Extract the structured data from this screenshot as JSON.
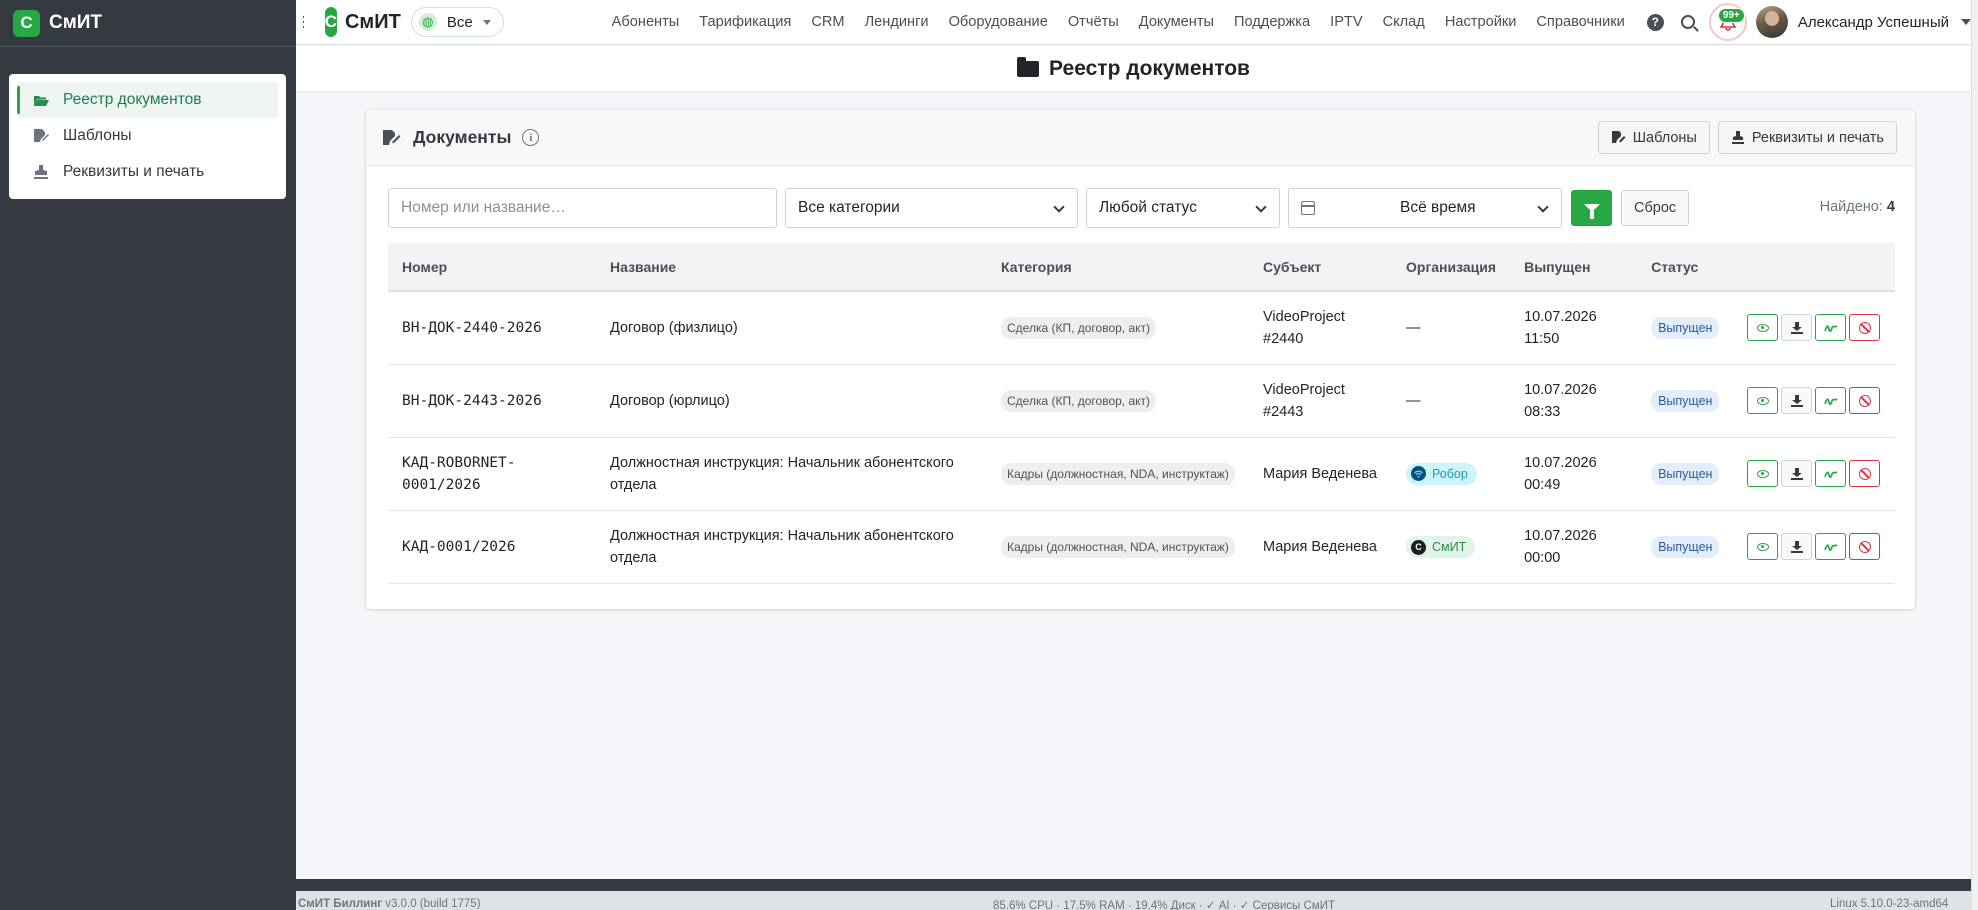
{
  "sidebar": {
    "brand": "СмИТ",
    "brand_letter": "С",
    "items": [
      {
        "label": "Реестр документов",
        "icon": "folder-open-icon",
        "active": true
      },
      {
        "label": "Шаблоны",
        "icon": "file-signature-icon",
        "active": false
      },
      {
        "label": "Реквизиты и печать",
        "icon": "stamp-icon",
        "active": false
      }
    ]
  },
  "navbar": {
    "brand": "СмИТ",
    "brand_letter": "С",
    "scope": "Все",
    "menu": [
      "Абоненты",
      "Тарификация",
      "CRM",
      "Лендинги",
      "Оборудование",
      "Отчёты",
      "Документы",
      "Поддержка",
      "IPTV",
      "Склад",
      "Настройки",
      "Справочники"
    ],
    "help_glyph": "?",
    "notifications_badge": "99+",
    "user_name": "Александр Успешный"
  },
  "page": {
    "title": "Реестр документов"
  },
  "card": {
    "title": "Документы",
    "info_glyph": "i",
    "templates_button": "Шаблоны",
    "requisites_button": "Реквизиты и печать"
  },
  "filters": {
    "search_placeholder": "Номер или название…",
    "category": "Все категории",
    "status": "Любой статус",
    "period": "Всё время",
    "reset": "Сброс",
    "found_label": "Найдено:",
    "found_count": "4"
  },
  "table": {
    "columns": [
      "Номер",
      "Название",
      "Категория",
      "Субъект",
      "Организация",
      "Выпущен",
      "Статус"
    ],
    "rows": [
      {
        "number": "ВН-ДОК-2440-2026",
        "name": "Договор (физлицо)",
        "category": "Сделка (КП, договор, акт)",
        "subject_line1": "VideoProject",
        "subject_line2": "#2440",
        "org": "—",
        "org_type": "none",
        "date": "10.07.2026",
        "time": "11:50",
        "status": "Выпущен"
      },
      {
        "number": "ВН-ДОК-2443-2026",
        "name": "Договор (юрлицо)",
        "category": "Сделка (КП, договор, акт)",
        "subject_line1": "VideoProject",
        "subject_line2": "#2443",
        "org": "—",
        "org_type": "none",
        "date": "10.07.2026",
        "time": "08:33",
        "status": "Выпущен"
      },
      {
        "number": "КАД-ROBORNET-0001/2026",
        "name_line1": "Должностная инструкция: Начальник абонентского",
        "name_line2": "отдела",
        "category": "Кадры (должностная, NDA, инструктаж)",
        "subject_line1": "Мария Веденева",
        "org": "Робор",
        "org_type": "robor",
        "date": "10.07.2026",
        "time": "00:49",
        "status": "Выпущен"
      },
      {
        "number": "КАД-0001/2026",
        "name_line1": "Должностная инструкция: Начальник абонентского",
        "name_line2": "отдела",
        "category": "Кадры (должностная, NDA, инструктаж)",
        "subject_line1": "Мария Веденева",
        "org": "СмИТ",
        "org_type": "smit",
        "date": "10.07.2026",
        "time": "00:00",
        "status": "Выпущен"
      }
    ]
  },
  "footer": {
    "left_bold": "СмИТ Биллинг",
    "left": "v3.0.0 (build 1775)",
    "center": "85.6% CPU · 17.5% RAM · 19.4% Диск · ✓ AI · ✓ Сервисы СмИТ",
    "right": "Linux 5.10.0-23-amd64"
  },
  "colors": {
    "accent": "#28a745",
    "sidebar_bg": "#343a40",
    "danger": "#dc3545",
    "status_badge": "#e3edfb"
  }
}
